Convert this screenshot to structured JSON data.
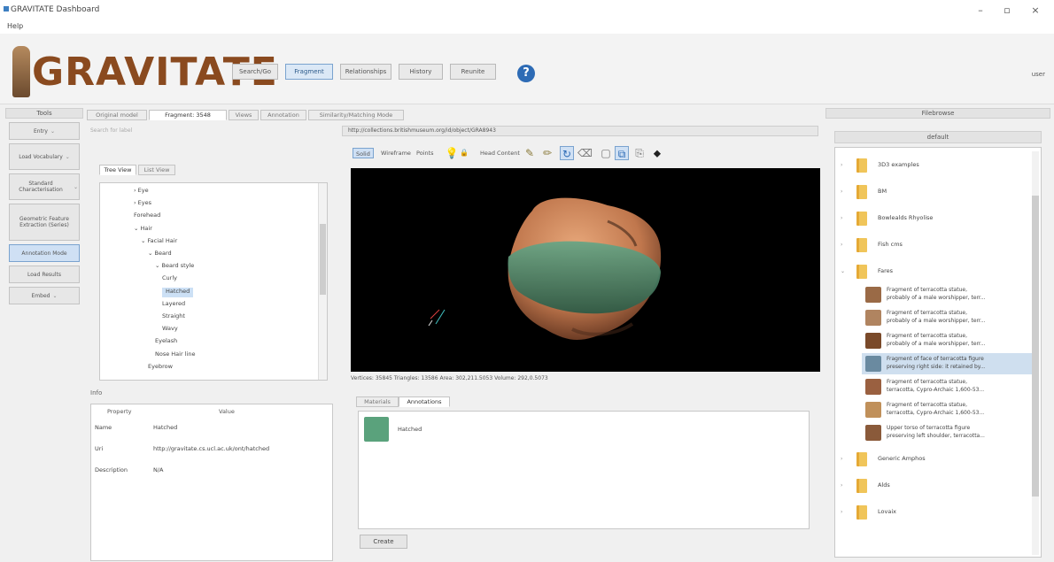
{
  "window": {
    "title": "GRAVITATE Dashboard",
    "controls": {
      "minimize": "–",
      "maximize": "▫",
      "close": "×"
    }
  },
  "menu": {
    "help": "Help"
  },
  "header": {
    "logo_text": "GRAVITATE",
    "nav": [
      {
        "label": "Search/Go",
        "active": false
      },
      {
        "label": "Fragment",
        "active": true
      },
      {
        "label": "Relationships",
        "active": false
      },
      {
        "label": "History",
        "active": false
      },
      {
        "label": "Reunite",
        "active": false
      }
    ],
    "help_label": "?",
    "right_text": "user"
  },
  "tools": {
    "title": "Tools",
    "buttons": [
      {
        "label": "Entry",
        "dropdown": true,
        "size": "small",
        "selected": false
      },
      {
        "label": "Load Vocabulary",
        "dropdown": true,
        "size": "tall",
        "selected": false
      },
      {
        "label": "Standard Characterisation",
        "dropdown": true,
        "size": "tall",
        "selected": false
      },
      {
        "label": "Geometric Feature Extraction (Series)",
        "dropdown": false,
        "size": "xtall",
        "selected": false
      },
      {
        "label": "Annotation Mode",
        "dropdown": false,
        "size": "small",
        "selected": true
      },
      {
        "label": "Load Results",
        "dropdown": false,
        "size": "small",
        "selected": false
      },
      {
        "label": "Embed",
        "dropdown": true,
        "size": "small",
        "selected": false
      }
    ]
  },
  "left": {
    "tabs": [
      "Original model",
      "Fragment: 3548",
      "Views",
      "Annotation",
      "Similarity/Matching Mode"
    ],
    "search_placeholder": "Search for label",
    "tree_tabs": [
      "Tree View",
      "List View"
    ],
    "tree": [
      {
        "label": "Eye",
        "prefix": "›",
        "indent": 1,
        "selected": false
      },
      {
        "label": "Eyes",
        "prefix": "›",
        "indent": 1,
        "selected": false
      },
      {
        "label": "Forehead",
        "prefix": "",
        "indent": 1,
        "selected": false
      },
      {
        "label": "Hair",
        "prefix": "⌄",
        "indent": 1,
        "selected": false
      },
      {
        "label": "Facial Hair",
        "prefix": "⌄",
        "indent": 2,
        "selected": false
      },
      {
        "label": "Beard",
        "prefix": "⌄",
        "indent": 3,
        "selected": false
      },
      {
        "label": "Beard style",
        "prefix": "⌄",
        "indent": 4,
        "selected": false
      },
      {
        "label": "Curly",
        "prefix": "",
        "indent": 5,
        "selected": false
      },
      {
        "label": "Hatched",
        "prefix": "",
        "indent": 5,
        "selected": true
      },
      {
        "label": "Layered",
        "prefix": "",
        "indent": 5,
        "selected": false
      },
      {
        "label": "Straight",
        "prefix": "",
        "indent": 5,
        "selected": false
      },
      {
        "label": "Wavy",
        "prefix": "",
        "indent": 5,
        "selected": false
      },
      {
        "label": "Eyelash",
        "prefix": "",
        "indent": 4,
        "selected": false
      },
      {
        "label": "Nose Hair line",
        "prefix": "",
        "indent": 4,
        "selected": false
      },
      {
        "label": "Eyebrow",
        "prefix": "",
        "indent": 3,
        "selected": false
      }
    ],
    "info_title": "Info",
    "info_headers": {
      "property": "Property",
      "value": "Value"
    },
    "info_rows": [
      {
        "property": "Name",
        "value": "Hatched"
      },
      {
        "property": "Uri",
        "value": "http://gravitate.cs.ucl.ac.uk/ont/hatched"
      },
      {
        "property": "Description",
        "value": "N/A"
      }
    ]
  },
  "center": {
    "url": "http://collections.britishmuseum.org/id/object/GRA8943",
    "toolbar": [
      "Solid",
      "Wireframe",
      "Points",
      "Head Content"
    ],
    "status": "Vertices: 35845    Triangles: 13586    Area: 302,211.5053          Volume: 292,0.5073",
    "subtabs": [
      "Materials",
      "Annotations"
    ],
    "annotation_label": "Hatched",
    "annotation_color": "#5aa27c",
    "create_label": "Create"
  },
  "right": {
    "title": "Filebrowse",
    "subtitle": "default",
    "folders": [
      {
        "name": "3D3 examples",
        "caret": "›"
      },
      {
        "name": "BM",
        "caret": "›"
      },
      {
        "name": "Bowlealds Rhyolise",
        "caret": "›"
      },
      {
        "name": "Fish cms",
        "caret": "›"
      },
      {
        "name": "Fares",
        "caret": "⌄"
      }
    ],
    "items": [
      {
        "line1": "Fragment of terracotta statue,",
        "line2": "probably of a male worshipper, terr...",
        "selected": false
      },
      {
        "line1": "Fragment of terracotta statue,",
        "line2": "probably of a male worshipper, terr...",
        "selected": false
      },
      {
        "line1": "Fragment of terracotta statue,",
        "line2": "probably of a male worshipper, terr...",
        "selected": false
      },
      {
        "line1": "Fragment of face of terracotta figure",
        "line2": "preserving right side: it retained by...",
        "selected": true
      },
      {
        "line1": "Fragment of terracotta statue,",
        "line2": "terracotta, Cypro-Archaic 1,600-53...",
        "selected": false
      },
      {
        "line1": "Fragment of terracotta statue,",
        "line2": "terracotta, Cypro-Archaic 1,600-53...",
        "selected": false
      },
      {
        "line1": "Upper torso of terracotta figure",
        "line2": "preserving left shoulder, terracotta...",
        "selected": false
      }
    ],
    "folders_after": [
      {
        "name": "Generic Amphos",
        "caret": "›"
      },
      {
        "name": "Alds",
        "caret": "›"
      },
      {
        "name": "Lovaix",
        "caret": "›"
      }
    ]
  }
}
